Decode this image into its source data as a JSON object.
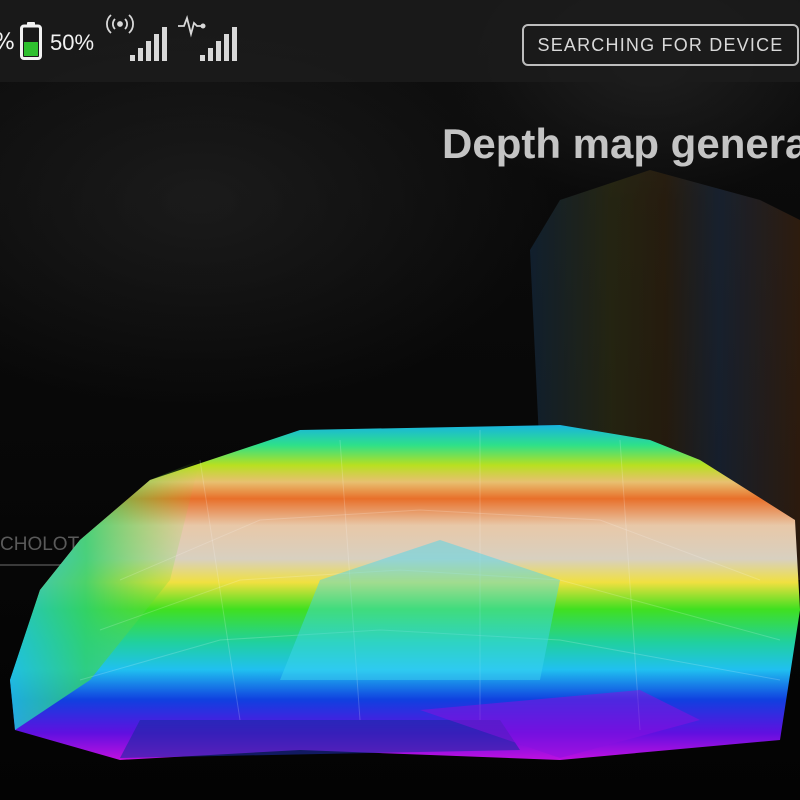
{
  "status": {
    "previous_percent": "%",
    "battery_percent": "50%",
    "battery_level": 0.5,
    "battery_color": "#2ec02e"
  },
  "header": {
    "device_button_label": "SEARCHING FOR DEVICE"
  },
  "main": {
    "title": "Depth map genera",
    "side_tab_label": "CHOLOT"
  },
  "icons": {
    "battery": "battery-icon",
    "signal": "wireless-signal-icon",
    "pulse": "sonar-pulse-icon"
  }
}
